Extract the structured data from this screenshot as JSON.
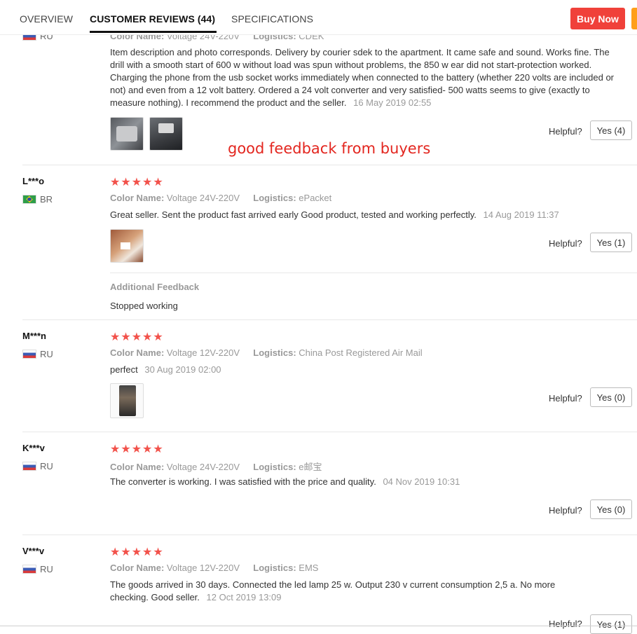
{
  "tabs": {
    "overview": "OVERVIEW",
    "reviews": "CUSTOMER REVIEWS (44)",
    "specs": "SPECIFICATIONS"
  },
  "buy_now": "Buy Now",
  "labels": {
    "color_name": "Color Name:",
    "logistics": "Logistics:",
    "helpful": "Helpful?",
    "additional_feedback": "Additional Feedback"
  },
  "annotation": "good feedback from buyers",
  "reviews": [
    {
      "country": "RU",
      "color": "Voltage 24V-220V",
      "logistics": "CDEK",
      "text": "Item description and photo corresponds. Delivery by courier sdek to the apartment. It came safe and sound. Works fine. The drill with a smooth start of 600 w without load was spun without problems, the 850 w ear did not start-protection worked. Charging the phone from the usb socket works immediately when connected to the battery (whether 220 volts are included or not) and even from a 12 volt battery. Ordered a 24 volt converter and very satisfied- 500 watts seems to give (exactly to measure nothing). I recommend the product and the seller.",
      "date": "16 May 2019 02:55",
      "helpful": "Yes (4)"
    },
    {
      "user": "L***o",
      "country": "BR",
      "stars": "★★★★★",
      "color": "Voltage 24V-220V",
      "logistics": "ePacket",
      "text": "Great seller. Sent the product fast arrived early Good product, tested and working perfectly.",
      "date": "14 Aug 2019 11:37",
      "helpful": "Yes (1)",
      "additional": "Stopped working"
    },
    {
      "user": "M***n",
      "country": "RU",
      "stars": "★★★★★",
      "color": "Voltage 12V-220V",
      "logistics": "China Post Registered Air Mail",
      "text": "perfect",
      "date": "30 Aug 2019 02:00",
      "helpful": "Yes (0)"
    },
    {
      "user": "K***v",
      "country": "RU",
      "stars": "★★★★★",
      "color": "Voltage 24V-220V",
      "logistics": "e邮宝",
      "text": "The converter is working. I was satisfied with the price and quality.",
      "date": "04 Nov 2019 10:31",
      "helpful": "Yes (0)"
    },
    {
      "user": "V***v",
      "country": "RU",
      "stars": "★★★★★",
      "color": "Voltage 12V-220V",
      "logistics": "EMS",
      "text": "The goods arrived in 30 days. Connected the led lamp 25 w. Output 230 v current consumption 2,5 a. No more checking. Good seller.",
      "date": "12 Oct 2019 13:09",
      "helpful": "Yes (1)"
    }
  ]
}
